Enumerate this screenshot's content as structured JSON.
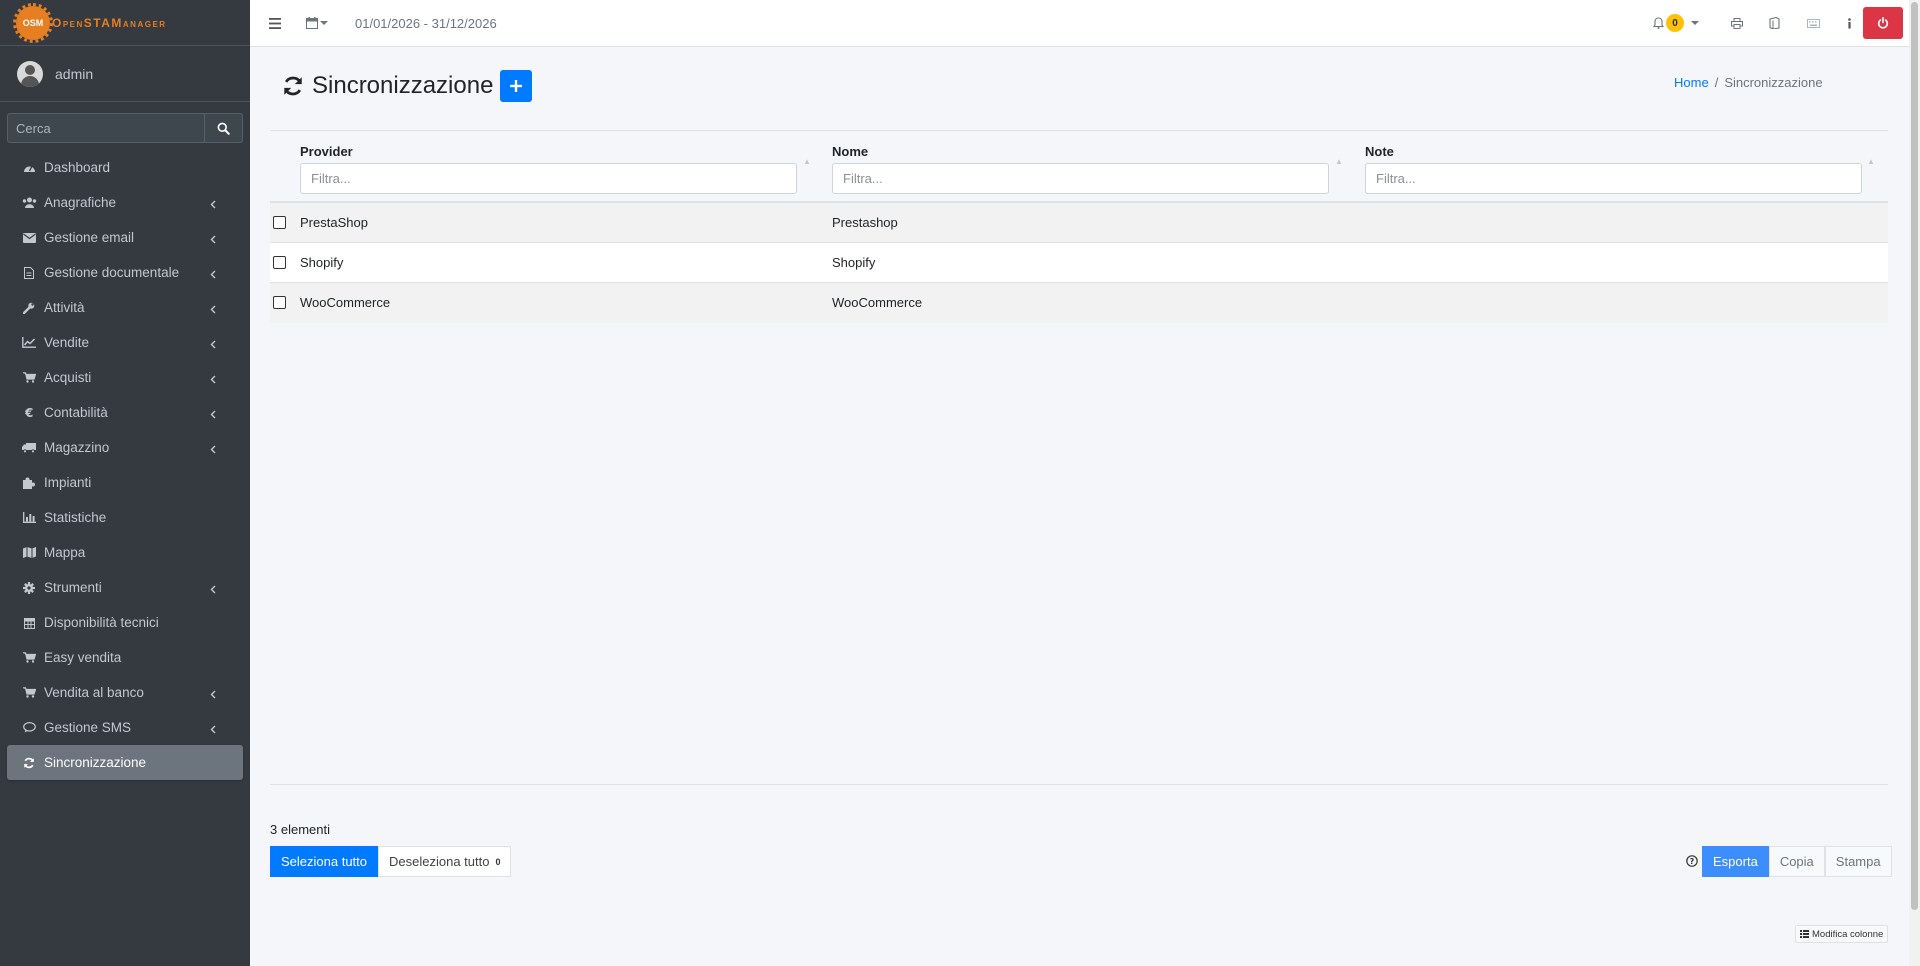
{
  "brand": {
    "logo_text": "OSM",
    "name": "OpenSTAManager",
    "color": "#e67e22"
  },
  "user": {
    "name": "admin"
  },
  "sidebar": {
    "search_placeholder": "Cerca",
    "items": [
      {
        "label": "Dashboard",
        "icon": "dashboard-icon",
        "submenu": false
      },
      {
        "label": "Anagrafiche",
        "icon": "users-icon",
        "submenu": true
      },
      {
        "label": "Gestione email",
        "icon": "envelope-icon",
        "submenu": true
      },
      {
        "label": "Gestione documentale",
        "icon": "document-icon",
        "submenu": true
      },
      {
        "label": "Attività",
        "icon": "wrench-icon",
        "submenu": true
      },
      {
        "label": "Vendite",
        "icon": "chart-line-icon",
        "submenu": true
      },
      {
        "label": "Acquisti",
        "icon": "cart-icon",
        "submenu": true
      },
      {
        "label": "Contabilità",
        "icon": "euro-icon",
        "submenu": true
      },
      {
        "label": "Magazzino",
        "icon": "truck-icon",
        "submenu": true
      },
      {
        "label": "Impianti",
        "icon": "puzzle-icon",
        "submenu": false
      },
      {
        "label": "Statistiche",
        "icon": "bar-chart-icon",
        "submenu": false
      },
      {
        "label": "Mappa",
        "icon": "map-icon",
        "submenu": false
      },
      {
        "label": "Strumenti",
        "icon": "gear-icon",
        "submenu": true
      },
      {
        "label": "Disponibilità tecnici",
        "icon": "calendar-icon",
        "submenu": false
      },
      {
        "label": "Easy vendita",
        "icon": "cart-icon",
        "submenu": false
      },
      {
        "label": "Vendita al banco",
        "icon": "cart-icon",
        "submenu": true
      },
      {
        "label": "Gestione SMS",
        "icon": "comment-icon",
        "submenu": true
      },
      {
        "label": "Sincronizzazione",
        "icon": "sync-icon",
        "submenu": false,
        "active": true
      }
    ]
  },
  "topbar": {
    "date_range": "01/01/2026 - 31/12/2026",
    "notification_count": "0",
    "power_color": "#dc3545"
  },
  "page": {
    "title": "Sincronizzazione",
    "breadcrumb": {
      "home": "Home",
      "current": "Sincronizzazione"
    }
  },
  "table": {
    "columns": [
      {
        "label": "Provider",
        "placeholder": "Filtra..."
      },
      {
        "label": "Nome",
        "placeholder": "Filtra..."
      },
      {
        "label": "Note",
        "placeholder": "Filtra..."
      }
    ],
    "rows": [
      {
        "provider": "PrestaShop",
        "nome": "Prestashop",
        "note": ""
      },
      {
        "provider": "Shopify",
        "nome": "Shopify",
        "note": ""
      },
      {
        "provider": "WooCommerce",
        "nome": "WooCommerce",
        "note": ""
      }
    ]
  },
  "footer": {
    "count_label": "3 elementi",
    "select_all": "Seleziona tutto",
    "deselect_all": "Deseleziona tutto",
    "selected_count": "0",
    "export": "Esporta",
    "copy": "Copia",
    "print": "Stampa",
    "modify_columns": "Modifica colonne"
  },
  "accent_color": "#007bff"
}
